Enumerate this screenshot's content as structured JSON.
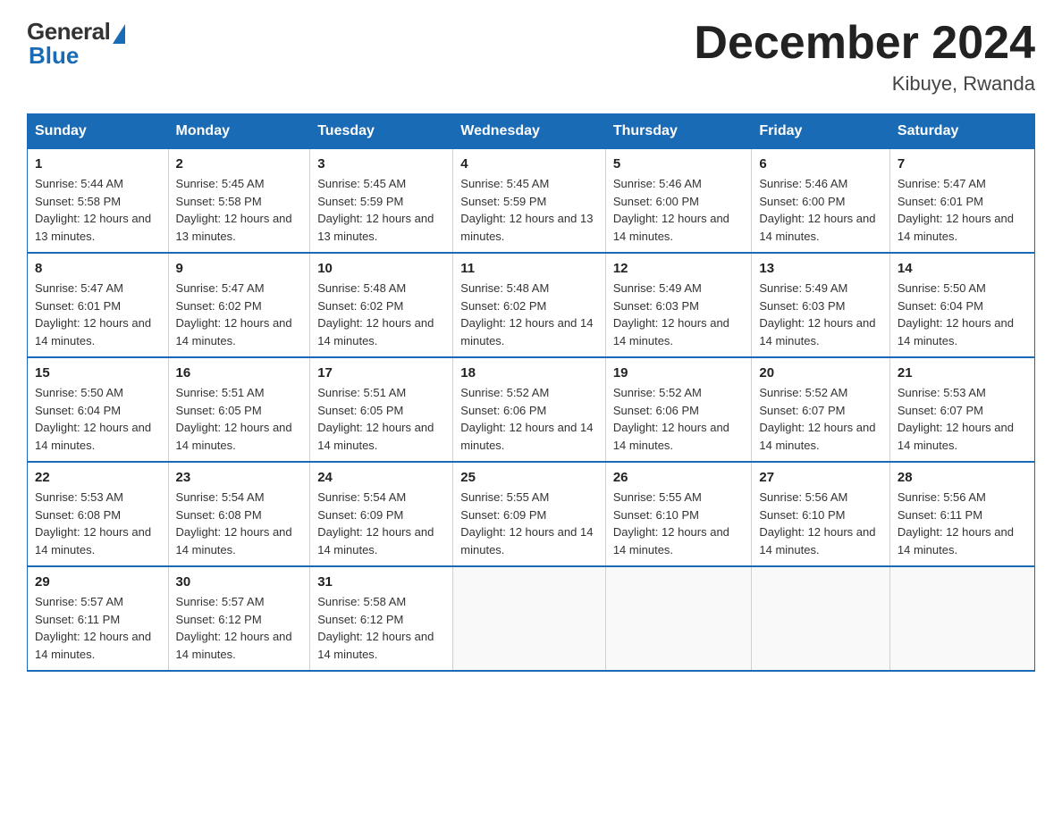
{
  "logo": {
    "general": "General",
    "blue": "Blue"
  },
  "header": {
    "month_title": "December 2024",
    "location": "Kibuye, Rwanda"
  },
  "days_of_week": [
    "Sunday",
    "Monday",
    "Tuesday",
    "Wednesday",
    "Thursday",
    "Friday",
    "Saturday"
  ],
  "weeks": [
    [
      {
        "day": "1",
        "sunrise": "5:44 AM",
        "sunset": "5:58 PM",
        "daylight": "12 hours and 13 minutes."
      },
      {
        "day": "2",
        "sunrise": "5:45 AM",
        "sunset": "5:58 PM",
        "daylight": "12 hours and 13 minutes."
      },
      {
        "day": "3",
        "sunrise": "5:45 AM",
        "sunset": "5:59 PM",
        "daylight": "12 hours and 13 minutes."
      },
      {
        "day": "4",
        "sunrise": "5:45 AM",
        "sunset": "5:59 PM",
        "daylight": "12 hours and 13 minutes."
      },
      {
        "day": "5",
        "sunrise": "5:46 AM",
        "sunset": "6:00 PM",
        "daylight": "12 hours and 14 minutes."
      },
      {
        "day": "6",
        "sunrise": "5:46 AM",
        "sunset": "6:00 PM",
        "daylight": "12 hours and 14 minutes."
      },
      {
        "day": "7",
        "sunrise": "5:47 AM",
        "sunset": "6:01 PM",
        "daylight": "12 hours and 14 minutes."
      }
    ],
    [
      {
        "day": "8",
        "sunrise": "5:47 AM",
        "sunset": "6:01 PM",
        "daylight": "12 hours and 14 minutes."
      },
      {
        "day": "9",
        "sunrise": "5:47 AM",
        "sunset": "6:02 PM",
        "daylight": "12 hours and 14 minutes."
      },
      {
        "day": "10",
        "sunrise": "5:48 AM",
        "sunset": "6:02 PM",
        "daylight": "12 hours and 14 minutes."
      },
      {
        "day": "11",
        "sunrise": "5:48 AM",
        "sunset": "6:02 PM",
        "daylight": "12 hours and 14 minutes."
      },
      {
        "day": "12",
        "sunrise": "5:49 AM",
        "sunset": "6:03 PM",
        "daylight": "12 hours and 14 minutes."
      },
      {
        "day": "13",
        "sunrise": "5:49 AM",
        "sunset": "6:03 PM",
        "daylight": "12 hours and 14 minutes."
      },
      {
        "day": "14",
        "sunrise": "5:50 AM",
        "sunset": "6:04 PM",
        "daylight": "12 hours and 14 minutes."
      }
    ],
    [
      {
        "day": "15",
        "sunrise": "5:50 AM",
        "sunset": "6:04 PM",
        "daylight": "12 hours and 14 minutes."
      },
      {
        "day": "16",
        "sunrise": "5:51 AM",
        "sunset": "6:05 PM",
        "daylight": "12 hours and 14 minutes."
      },
      {
        "day": "17",
        "sunrise": "5:51 AM",
        "sunset": "6:05 PM",
        "daylight": "12 hours and 14 minutes."
      },
      {
        "day": "18",
        "sunrise": "5:52 AM",
        "sunset": "6:06 PM",
        "daylight": "12 hours and 14 minutes."
      },
      {
        "day": "19",
        "sunrise": "5:52 AM",
        "sunset": "6:06 PM",
        "daylight": "12 hours and 14 minutes."
      },
      {
        "day": "20",
        "sunrise": "5:52 AM",
        "sunset": "6:07 PM",
        "daylight": "12 hours and 14 minutes."
      },
      {
        "day": "21",
        "sunrise": "5:53 AM",
        "sunset": "6:07 PM",
        "daylight": "12 hours and 14 minutes."
      }
    ],
    [
      {
        "day": "22",
        "sunrise": "5:53 AM",
        "sunset": "6:08 PM",
        "daylight": "12 hours and 14 minutes."
      },
      {
        "day": "23",
        "sunrise": "5:54 AM",
        "sunset": "6:08 PM",
        "daylight": "12 hours and 14 minutes."
      },
      {
        "day": "24",
        "sunrise": "5:54 AM",
        "sunset": "6:09 PM",
        "daylight": "12 hours and 14 minutes."
      },
      {
        "day": "25",
        "sunrise": "5:55 AM",
        "sunset": "6:09 PM",
        "daylight": "12 hours and 14 minutes."
      },
      {
        "day": "26",
        "sunrise": "5:55 AM",
        "sunset": "6:10 PM",
        "daylight": "12 hours and 14 minutes."
      },
      {
        "day": "27",
        "sunrise": "5:56 AM",
        "sunset": "6:10 PM",
        "daylight": "12 hours and 14 minutes."
      },
      {
        "day": "28",
        "sunrise": "5:56 AM",
        "sunset": "6:11 PM",
        "daylight": "12 hours and 14 minutes."
      }
    ],
    [
      {
        "day": "29",
        "sunrise": "5:57 AM",
        "sunset": "6:11 PM",
        "daylight": "12 hours and 14 minutes."
      },
      {
        "day": "30",
        "sunrise": "5:57 AM",
        "sunset": "6:12 PM",
        "daylight": "12 hours and 14 minutes."
      },
      {
        "day": "31",
        "sunrise": "5:58 AM",
        "sunset": "6:12 PM",
        "daylight": "12 hours and 14 minutes."
      },
      null,
      null,
      null,
      null
    ]
  ],
  "labels": {
    "sunrise": "Sunrise: ",
    "sunset": "Sunset: ",
    "daylight": "Daylight: "
  }
}
